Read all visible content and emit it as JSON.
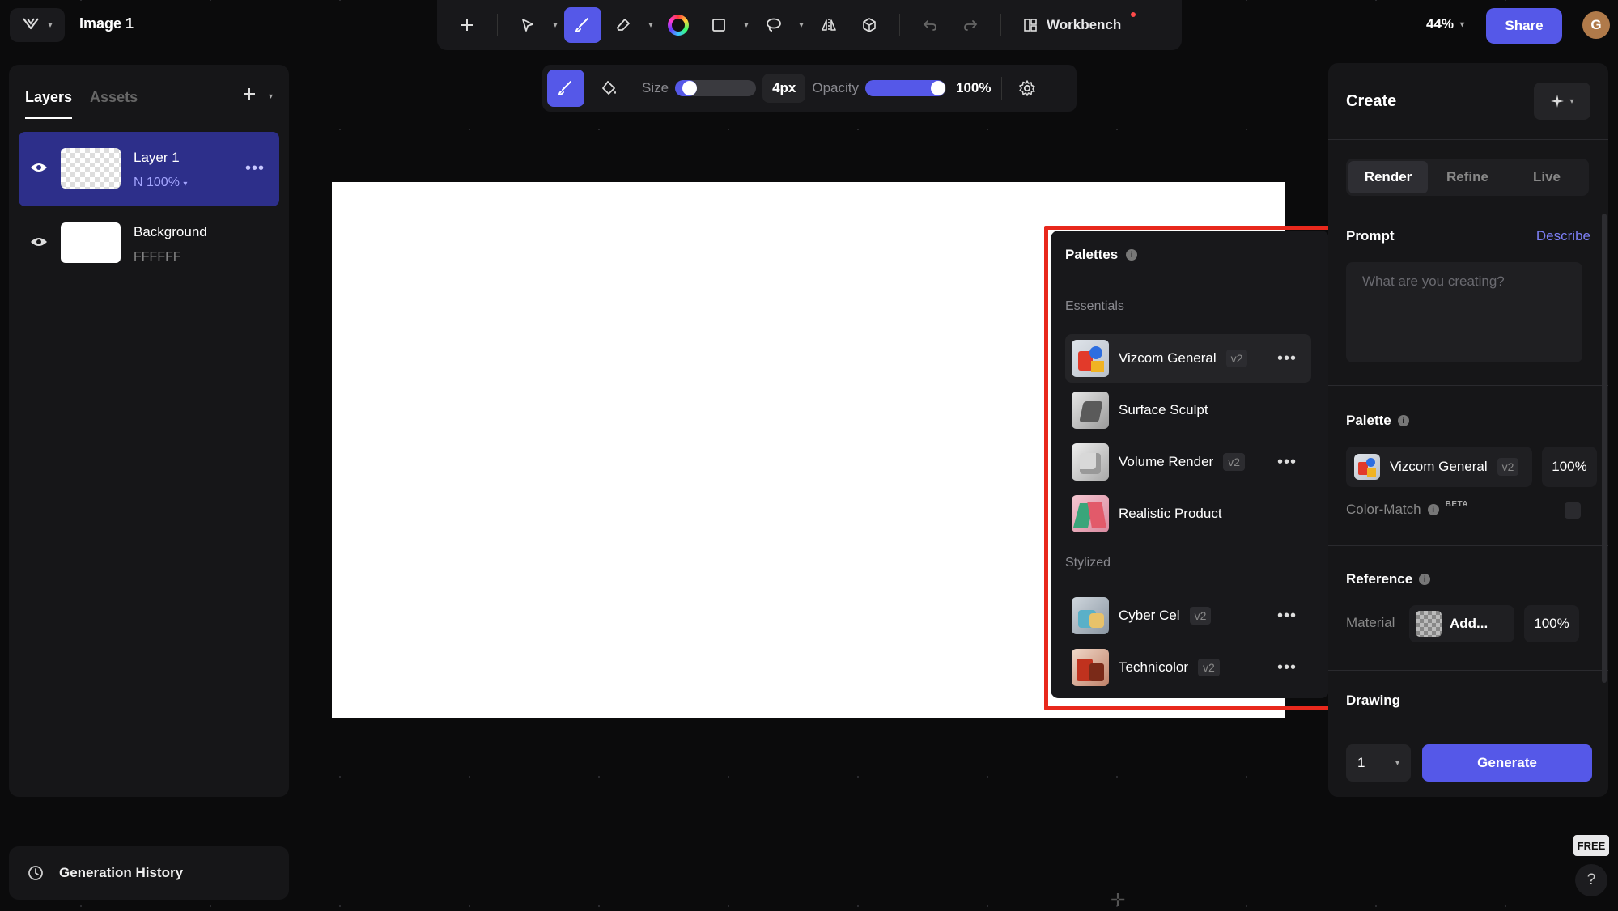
{
  "app": {
    "title": "Image 1",
    "zoom": "44%",
    "share_label": "Share",
    "avatar_initial": "G"
  },
  "toolbar": {
    "workbench_label": "Workbench",
    "active_tool": "brush"
  },
  "brush": {
    "size_label": "Size",
    "size_value": "4px",
    "size_fraction": 0.1,
    "opacity_label": "Opacity",
    "opacity_value": "100%",
    "opacity_fraction": 1.0
  },
  "layers_panel": {
    "tabs": [
      "Layers",
      "Assets"
    ],
    "layers": [
      {
        "name": "Layer 1",
        "sub": "N 100%",
        "selected": true
      },
      {
        "name": "Background",
        "sub": "FFFFFF",
        "selected": false
      }
    ],
    "generation_history_label": "Generation History"
  },
  "palettes": {
    "title": "Palettes",
    "sections": [
      {
        "label": "Essentials",
        "items": [
          {
            "name": "Vizcom General",
            "badge": "v2",
            "more": true
          },
          {
            "name": "Surface Sculpt",
            "badge": "",
            "more": false
          },
          {
            "name": "Volume Render",
            "badge": "v2",
            "more": true
          },
          {
            "name": "Realistic Product",
            "badge": "",
            "more": false
          }
        ]
      },
      {
        "label": "Stylized",
        "items": [
          {
            "name": "Cyber Cel",
            "badge": "v2",
            "more": true
          },
          {
            "name": "Technicolor",
            "badge": "v2",
            "more": true
          }
        ]
      }
    ]
  },
  "create_panel": {
    "title": "Create",
    "tabs": [
      "Render",
      "Refine",
      "Live"
    ],
    "prompt_label": "Prompt",
    "describe_label": "Describe",
    "prompt_placeholder": "What are you creating?",
    "palette_label": "Palette",
    "palette_selected": "Vizcom General",
    "palette_badge": "v2",
    "palette_strength": "100%",
    "color_match_label": "Color-Match",
    "beta_label": "BETA",
    "reference_label": "Reference",
    "material_label": "Material",
    "material_add_label": "Add...",
    "material_strength": "100%",
    "drawing_label": "Drawing",
    "count_value": "1",
    "generate_label": "Generate"
  },
  "misc": {
    "free_badge": "FREE",
    "help_label": "?"
  },
  "colors": {
    "accent": "#5558e8",
    "highlight": "#e8281c",
    "canvas": "#ffffff"
  }
}
